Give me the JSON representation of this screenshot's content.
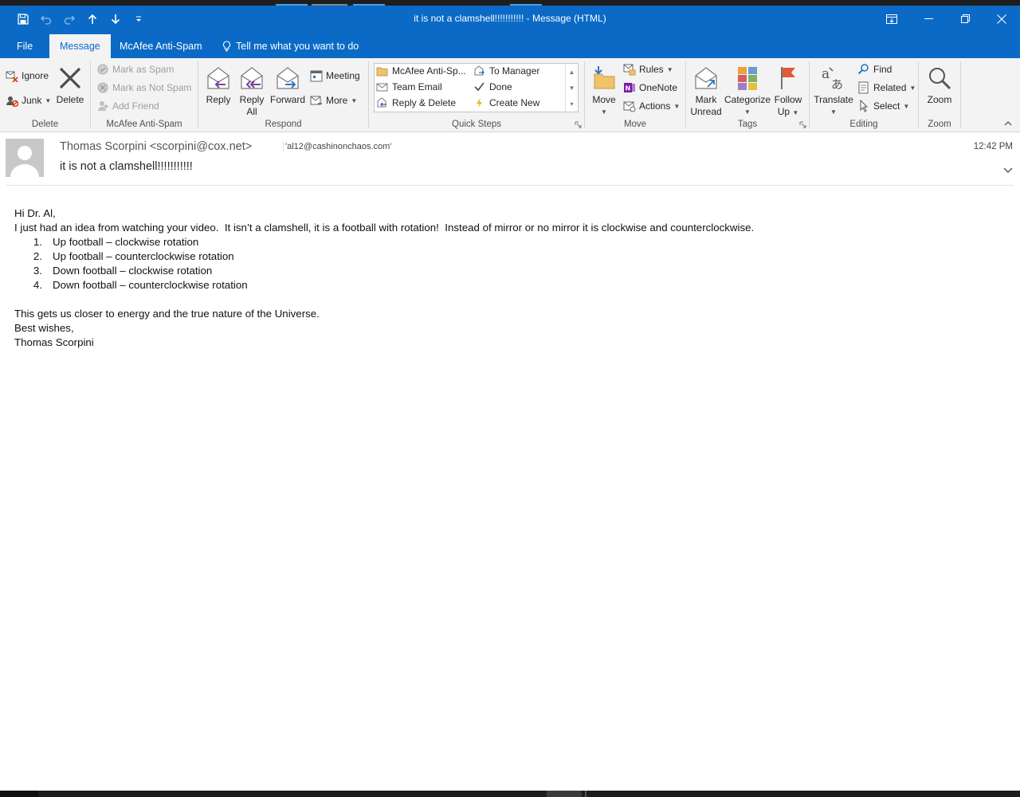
{
  "window": {
    "title": "it is not a clamshell!!!!!!!!!!! - Message (HTML)"
  },
  "tabs": [
    {
      "label": "File"
    },
    {
      "label": "Message"
    },
    {
      "label": "McAfee Anti-Spam"
    },
    {
      "label": "Tell me what you want to do"
    }
  ],
  "ribbon": {
    "delete_group": {
      "label": "Delete",
      "ignore": "Ignore",
      "junk": "Junk",
      "delete": "Delete"
    },
    "mcafee_group": {
      "label": "McAfee Anti-Spam",
      "mark_spam": "Mark as Spam",
      "mark_not_spam": "Mark as Not Spam",
      "add_friend": "Add Friend"
    },
    "respond_group": {
      "label": "Respond",
      "reply": "Reply",
      "reply_all_1": "Reply",
      "reply_all_2": "All",
      "forward": "Forward",
      "meeting": "Meeting",
      "more": "More"
    },
    "quicksteps_group": {
      "label": "Quick Steps",
      "items": [
        "McAfee Anti-Sp...",
        "To Manager",
        "Team Email",
        "Done",
        "Reply & Delete",
        "Create New"
      ]
    },
    "move_group": {
      "label": "Move",
      "move": "Move",
      "rules": "Rules",
      "onenote": "OneNote",
      "actions": "Actions"
    },
    "tags_group": {
      "label": "Tags",
      "mark_unread_1": "Mark",
      "mark_unread_2": "Unread",
      "categorize": "Categorize",
      "follow_up_1": "Follow",
      "follow_up_2": "Up"
    },
    "editing_group": {
      "label": "Editing",
      "translate": "Translate",
      "find": "Find",
      "related": "Related",
      "select": "Select"
    },
    "zoom_group": {
      "label": "Zoom",
      "zoom": "Zoom"
    }
  },
  "message": {
    "sender": "Thomas Scorpini <scorpini@cox.net>",
    "recipient": "'al12@cashinonchaos.com'",
    "subject": "it is not a clamshell!!!!!!!!!!!",
    "time": "12:42 PM",
    "greeting": "Hi Dr. Al,",
    "intro": "I just had an idea from watching your video.  It isn’t a clamshell, it is a football with rotation!  Instead of mirror or no mirror it is clockwise and counterclockwise.",
    "list": [
      {
        "num": "1.",
        "text": "Up football – clockwise rotation"
      },
      {
        "num": "2.",
        "text": "Up football – counterclockwise rotation"
      },
      {
        "num": "3.",
        "text": "Down football – clockwise rotation"
      },
      {
        "num": "4.",
        "text": "Down football – counterclockwise rotation"
      }
    ],
    "closing": "This gets us closer to energy and the true nature of the Universe.",
    "signoff": "Best wishes,",
    "signature": "Thomas Scorpini"
  },
  "colors": {
    "accent": "#0b6ac6",
    "ribbon_bg": "#f3f3f3"
  }
}
